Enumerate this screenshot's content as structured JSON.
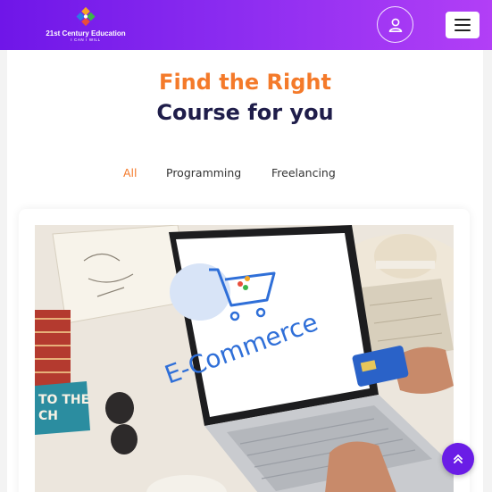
{
  "header": {
    "brand_name": "21st Century Education",
    "brand_tagline": "I CAN I WILL",
    "user_icon": "user-icon",
    "menu_icon": "hamburger-menu-icon",
    "gradient": [
      "#6f16e8",
      "#b23ff6"
    ]
  },
  "hero": {
    "title_line1": "Find the Right",
    "title_line2": "Course for you",
    "accent_color": "#f47a2a",
    "dark_color": "#1f1d4a"
  },
  "filters": {
    "items": [
      "All",
      "Programming",
      "Freelancing"
    ],
    "active": "All"
  },
  "course_card": {
    "image_text": "E-Commerce",
    "sign_text_line1": "TO THE",
    "sign_text_line2": "CH"
  },
  "scroll_top": {
    "icon": "double-chevron-up-icon",
    "color": "#6a1de6"
  }
}
